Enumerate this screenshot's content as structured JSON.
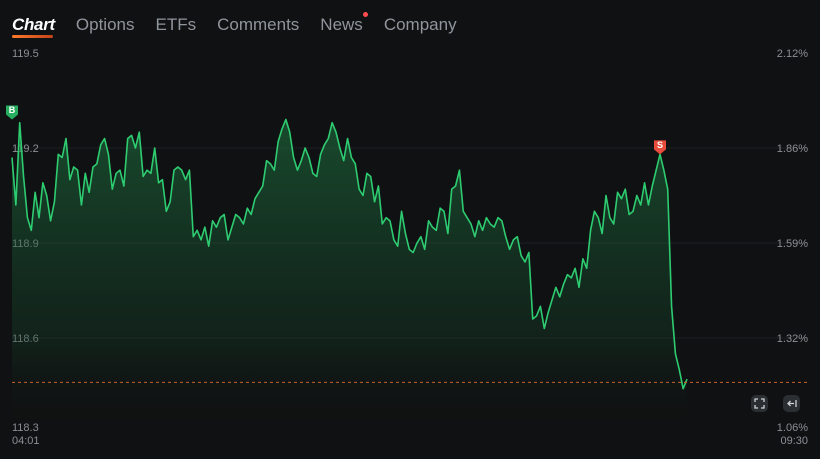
{
  "tabs": [
    {
      "label": "Chart",
      "active": true
    },
    {
      "label": "Options"
    },
    {
      "label": "ETFs"
    },
    {
      "label": "Comments"
    },
    {
      "label": "News",
      "badge": true
    },
    {
      "label": "Company"
    }
  ],
  "colors": {
    "line": "#2ecc71",
    "fill": "#1f7a43",
    "reference": "#c8602a",
    "buy_marker": "#27ae60",
    "sell_marker": "#e74c3c",
    "accent": "#ff7a2a"
  },
  "chart_data": {
    "type": "area",
    "left_axis": {
      "ticks": [
        "119.5",
        "119.2",
        "118.9",
        "118.6",
        "118.3"
      ],
      "ylim": [
        118.3,
        119.5
      ]
    },
    "right_axis": {
      "ticks": [
        "2.12%",
        "1.86%",
        "1.59%",
        "1.32%",
        "1.06%"
      ]
    },
    "x_labels": {
      "start": "04:01",
      "end": "09:30"
    },
    "reference_line": {
      "value": 118.46
    },
    "markers": [
      {
        "label": "B",
        "type": "buy",
        "price": 119.29,
        "index": 0
      },
      {
        "label": "S",
        "type": "sell",
        "price": 119.18,
        "index": 168
      }
    ],
    "values": [
      119.17,
      119.02,
      119.28,
      119.11,
      118.98,
      118.94,
      119.06,
      118.98,
      119.09,
      119.05,
      118.97,
      119.03,
      119.18,
      119.17,
      119.23,
      119.1,
      119.14,
      119.13,
      119.02,
      119.12,
      119.06,
      119.14,
      119.15,
      119.21,
      119.23,
      119.18,
      119.07,
      119.12,
      119.13,
      119.08,
      119.23,
      119.24,
      119.2,
      119.25,
      119.11,
      119.13,
      119.12,
      119.2,
      119.09,
      119.1,
      119.0,
      119.03,
      119.13,
      119.14,
      119.13,
      119.1,
      119.13,
      118.92,
      118.94,
      118.91,
      118.95,
      118.89,
      118.97,
      118.95,
      118.98,
      118.99,
      118.91,
      118.95,
      118.99,
      118.98,
      118.96,
      119.01,
      118.99,
      119.04,
      119.06,
      119.08,
      119.16,
      119.15,
      119.13,
      119.22,
      119.26,
      119.29,
      119.25,
      119.17,
      119.13,
      119.16,
      119.2,
      119.17,
      119.12,
      119.11,
      119.18,
      119.21,
      119.23,
      119.28,
      119.25,
      119.2,
      119.16,
      119.23,
      119.17,
      119.15,
      119.07,
      119.05,
      119.12,
      119.11,
      119.03,
      119.08,
      118.96,
      118.98,
      118.97,
      118.91,
      118.89,
      119.0,
      118.93,
      118.88,
      118.87,
      118.9,
      118.92,
      118.88,
      118.97,
      118.95,
      118.94,
      119.01,
      119.0,
      118.93,
      119.07,
      119.08,
      119.13,
      119.0,
      118.98,
      118.96,
      118.92,
      118.97,
      118.94,
      118.98,
      118.96,
      118.95,
      118.98,
      118.97,
      118.92,
      118.88,
      118.91,
      118.92,
      118.86,
      118.84,
      118.87,
      118.66,
      118.67,
      118.7,
      118.63,
      118.68,
      118.72,
      118.76,
      118.73,
      118.77,
      118.8,
      118.79,
      118.82,
      118.76,
      118.85,
      118.82,
      118.94,
      119.0,
      118.98,
      118.93,
      119.05,
      118.98,
      118.96,
      119.06,
      119.04,
      119.07,
      118.99,
      119.0,
      119.05,
      119.02,
      119.09,
      119.02,
      119.08,
      119.13,
      119.18,
      119.13,
      119.07,
      118.7,
      118.55,
      118.5,
      118.44,
      118.47
    ]
  },
  "controls": [
    {
      "name": "fullscreen-icon"
    },
    {
      "name": "collapse-left-icon"
    }
  ]
}
